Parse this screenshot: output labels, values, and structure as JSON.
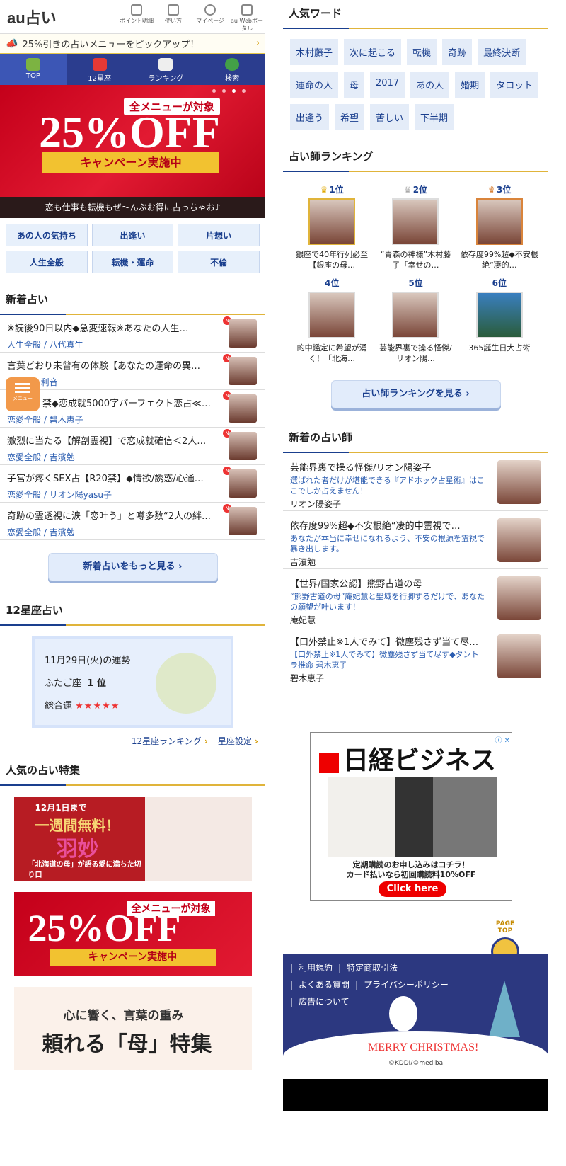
{
  "header": {
    "logo": "au占い",
    "nav": [
      {
        "label": "ポイント明細",
        "icon": "receipt-icon"
      },
      {
        "label": "使い方",
        "icon": "book-icon"
      },
      {
        "label": "マイページ",
        "icon": "person-icon"
      },
      {
        "label": "au Webポータル",
        "icon": "home-icon"
      }
    ]
  },
  "pickup": {
    "text": "25%引きの占いメニューをピックアップ！",
    "icon": "megaphone-icon"
  },
  "tabs": [
    {
      "label": "TOP",
      "active": true
    },
    {
      "label": "12星座"
    },
    {
      "label": "ランキング"
    },
    {
      "label": "検索"
    }
  ],
  "hero": {
    "tag": "全メニューが対象",
    "big": "25%OFF",
    "ribbon": "キャンペーン実施中",
    "caption": "恋も仕事も転機もぜ〜んぶお得に占っちゃお♪"
  },
  "categories": [
    "あの人の気持ち",
    "出逢い",
    "片想い",
    "人生全般",
    "転機・運命",
    "不倫"
  ],
  "new_section": {
    "title": "新着占い",
    "more": "新着占いをもっと見る",
    "badge": "N",
    "items": [
      {
        "title": "※読後90日以内◆急変速報※あなたの人生…",
        "sub": "人生全般 / 八代真生"
      },
      {
        "title": "言葉どおり未曾有の体験【あなたの運命の異…",
        "sub": "出逢い / 利音"
      },
      {
        "title": "禁◆恋成就5000字パーフェクト恋占≪…",
        "sub": "恋愛全般 / 碧木恵子"
      },
      {
        "title": "激烈に当たる【解剖霊視】で恋成就確信＜2人…",
        "sub": "恋愛全般 / 吉濱勉"
      },
      {
        "title": "子宮が疼くSEX占【R20禁】◆情欲/誘惑/心通…",
        "sub": "恋愛全般 / リオン陽yasu子"
      },
      {
        "title": "奇跡の霊透視に涙「恋叶う」と噂多数“2人の絆…",
        "sub": "恋愛全般 / 吉濱勉"
      }
    ]
  },
  "menu_float": {
    "label": "メニュー"
  },
  "zodiac": {
    "title": "12星座占い",
    "date": "11月29日(火)の運勢",
    "sign": "ふたご座",
    "rank": "1 位",
    "overall_label": "総合運",
    "stars": "★★★★★",
    "links": [
      "12星座ランキング",
      "星座設定"
    ]
  },
  "features": {
    "title": "人気の占い特集",
    "banners": [
      {
        "line1": "12月1日まで",
        "line2": "一週間無料！",
        "name": "羽妙",
        "sub": "「北海道の母」が語る愛に満ちた切り口"
      },
      {
        "tag": "全メニューが対象",
        "big": "25%OFF",
        "ribbon": "キャンペーン実施中"
      },
      {
        "line1": "心に響く、言葉の重み",
        "line2": "頼れる「母」特集"
      }
    ]
  },
  "keywords": {
    "title": "人気ワード",
    "items": [
      "木村藤子",
      "次に起こる",
      "転機",
      "奇跡",
      "最終決断",
      "運命の人",
      "母",
      "2017",
      "あの人",
      "婚期",
      "タロット",
      "出逢う",
      "希望",
      "苦しい",
      "下半期"
    ]
  },
  "ranking": {
    "title": "占い師ランキング",
    "more": "占い師ランキングを見る",
    "items": [
      {
        "pos": "1位",
        "name": "銀座で40年行列必至【銀座の母…"
      },
      {
        "pos": "2位",
        "name": "“青森の神様”木村藤子「幸せの…"
      },
      {
        "pos": "3位",
        "name": "依存度99%超◆不安根絶“凄的…"
      },
      {
        "pos": "4位",
        "name": "的中鑑定に希望が湧く！「北海…"
      },
      {
        "pos": "5位",
        "name": "芸能界裏で操る怪傑/リオン陽…"
      },
      {
        "pos": "6位",
        "name": "365誕生日大占術"
      }
    ]
  },
  "new_fortune_tellers": {
    "title": "新着の占い師",
    "items": [
      {
        "title": "芸能界裏で操る怪傑/リオン陽姿子",
        "desc": "選ばれた者だけが堪能できる『アドホック占星術』はここでしか占えません！",
        "author": "リオン陽姿子"
      },
      {
        "title": "依存度99%超◆不安根絶“凄的中霊視で…",
        "desc": "あなたが本当に幸せになれるよう、不安の根源を霊視で暴き出します。",
        "author": "吉濱勉"
      },
      {
        "title": "【世界/国家公認】熊野古道の母",
        "desc": "“熊野古道の母”庵妃慧と聖域を行脚するだけで、あなたの願望が叶います！",
        "author": "庵妃慧"
      },
      {
        "title": "【口外禁止※1人でみて】微塵残さず当て尽…",
        "desc": "【口外禁止※1人でみて】微塵残さず当て尽す◆タントラ推命 碧木恵子",
        "author": "碧木恵子"
      }
    ]
  },
  "ad": {
    "brand": "日経ビジネス",
    "copy1": "定期購読のお申し込みはコチラ！",
    "copy2": "カード払いなら初回購読料10%OFF",
    "cta": "Click here",
    "close": "ⓘ ✕"
  },
  "pagetop": {
    "label": "PAGE TOP"
  },
  "footer": {
    "links": [
      "利用規約",
      "特定商取引法",
      "よくある質問",
      "プライバシーポリシー",
      "広告について"
    ],
    "xmas": "MERRY CHRISTMAS!",
    "copyright": "©KDDI/©mediba"
  }
}
